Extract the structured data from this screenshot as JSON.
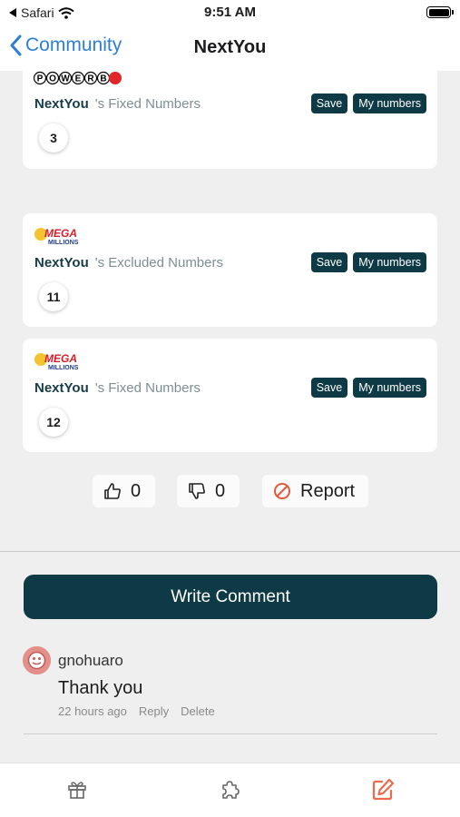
{
  "status_bar": {
    "carrier": "Safari",
    "time": "9:51 AM"
  },
  "nav": {
    "back_label": "Community",
    "title": "NextYou"
  },
  "cards": [
    {
      "logo": "POWERBALL",
      "user": "NextYou",
      "kind": "'s Fixed Numbers",
      "save_label": "Save",
      "my_numbers_label": "My numbers",
      "number": "3"
    },
    {
      "logo": "MEGA MILLIONS",
      "user": "NextYou",
      "kind": "'s Excluded Numbers",
      "save_label": "Save",
      "my_numbers_label": "My numbers",
      "number": "11"
    },
    {
      "logo": "MEGA MILLIONS",
      "user": "NextYou",
      "kind": "'s Fixed Numbers",
      "save_label": "Save",
      "my_numbers_label": "My numbers",
      "number": "12"
    }
  ],
  "reactions": {
    "likes": "0",
    "dislikes": "0",
    "report_label": "Report"
  },
  "write_comment_label": "Write Comment",
  "comment": {
    "user": "gnohuaro",
    "text": "Thank you",
    "time": "22 hours ago",
    "reply_label": "Reply",
    "delete_label": "Delete"
  },
  "tabs": [
    {
      "icon": "gift-icon",
      "active": false
    },
    {
      "icon": "puzzle-icon",
      "active": false
    },
    {
      "icon": "edit-icon",
      "active": true
    }
  ],
  "colors": {
    "accent": "#0e3a45",
    "back": "#2d7fd6",
    "report": "#e45a3c",
    "active_tab": "#ef6a4b"
  }
}
